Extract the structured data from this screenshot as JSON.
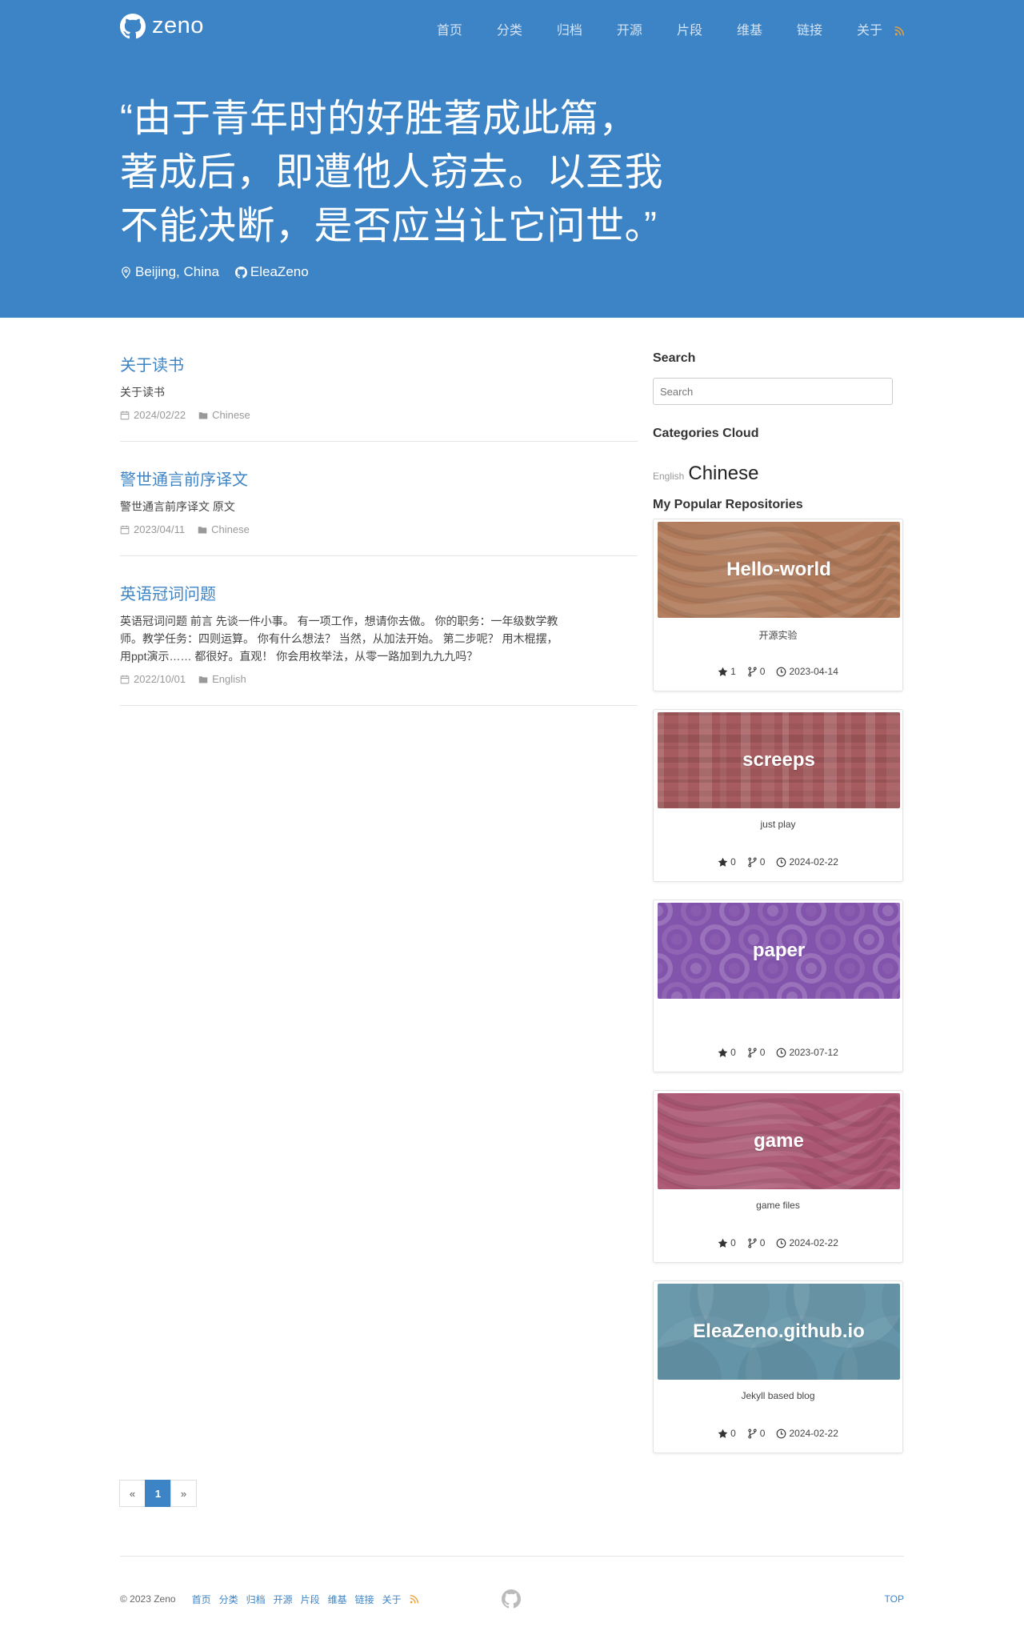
{
  "brand": {
    "name": "zeno",
    "logo_icon": "github-icon"
  },
  "nav": {
    "items": [
      "首页",
      "分类",
      "归档",
      "开源",
      "片段",
      "维基",
      "链接",
      "关于"
    ],
    "rss_icon": "rss-icon"
  },
  "hero": {
    "quote_lines": [
      "“由于青年时的好胜著成此篇，",
      "著成后，即遭他人窃去。以至我",
      "不能决断，是否应当让它问世。”"
    ],
    "location": "Beijing, China",
    "github_user": "EleaZeno"
  },
  "posts": [
    {
      "title": "关于读书",
      "excerpt": "关于读书",
      "date": "2024/02/22",
      "category": "Chinese"
    },
    {
      "title": "警世通言前序译文",
      "excerpt": "警世通言前序译文 原文",
      "date": "2023/04/11",
      "category": "Chinese"
    },
    {
      "title": "英语冠词问题",
      "excerpt": "英语冠词问题 前言 先谈一件小事。 有一项工作，想请你去做。 你的职务：一年级数学教师。教学任务：四则运算。 你有什么想法？ 当然，从加法开始。 第二步呢？ 用木棍摆，用ppt演示…… 都很好。直观！ 你会用枚举法，从零一路加到九九九吗？",
      "date": "2022/10/01",
      "category": "English"
    }
  ],
  "sidebar": {
    "search_title": "Search",
    "search_placeholder": "Search",
    "categories_title": "Categories Cloud",
    "categories": [
      {
        "name": "English",
        "size": "small"
      },
      {
        "name": "Chinese",
        "size": "large"
      }
    ],
    "repos_title": "My Popular Repositories",
    "repos": [
      {
        "name": "Hello-world",
        "description": "开源实验",
        "stars": "1",
        "forks": "0",
        "date": "2023-04-14",
        "color": "#b07a5a",
        "pattern": "waves"
      },
      {
        "name": "screeps",
        "description": "just play",
        "stars": "0",
        "forks": "0",
        "date": "2024-02-22",
        "color": "#a65b5e",
        "pattern": "plaid"
      },
      {
        "name": "paper",
        "description": "",
        "stars": "0",
        "forks": "0",
        "date": "2023-07-12",
        "color": "#8354ac",
        "pattern": "circles"
      },
      {
        "name": "game",
        "description": "game files",
        "stars": "0",
        "forks": "0",
        "date": "2024-02-22",
        "color": "#ab5673",
        "pattern": "waves"
      },
      {
        "name": "EleaZeno.github.io",
        "description": "Jekyll based blog",
        "stars": "0",
        "forks": "0",
        "date": "2024-02-22",
        "color": "#5a8ea3",
        "pattern": "arcs"
      }
    ]
  },
  "pagination": {
    "prev": "«",
    "current": "1",
    "next": "»"
  },
  "footer": {
    "copyright": "© 2023 Zeno",
    "links": [
      "首页",
      "分类",
      "归档",
      "开源",
      "片段",
      "维基",
      "链接",
      "关于"
    ],
    "top": "TOP"
  },
  "colors": {
    "primary": "#3d84c6",
    "rss": "#f0a030"
  }
}
